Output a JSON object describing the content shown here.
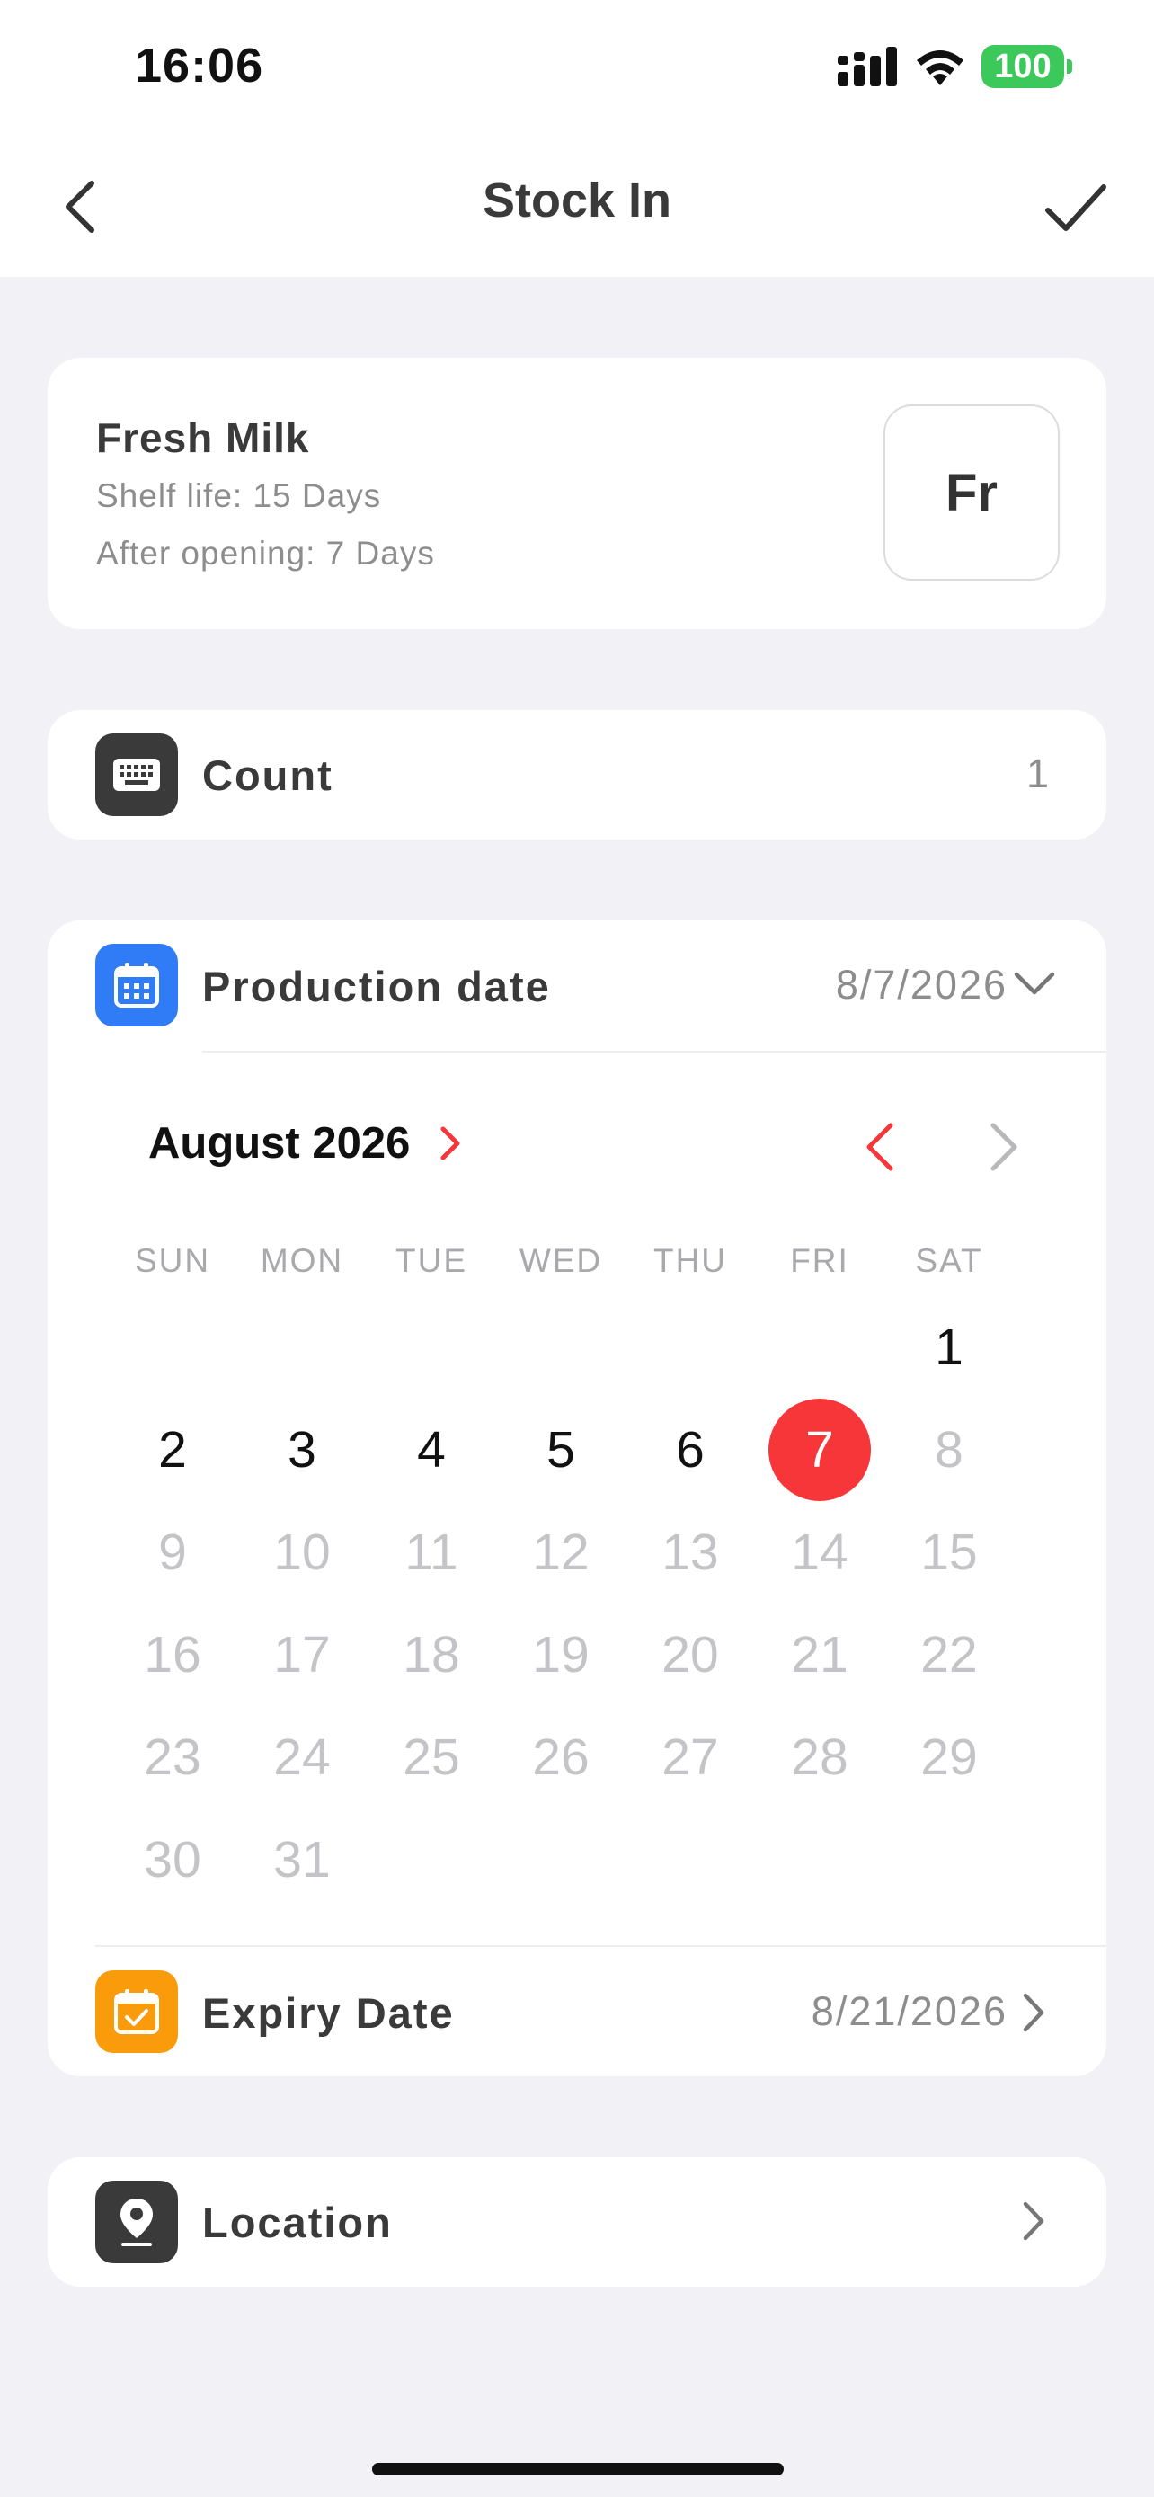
{
  "status": {
    "time": "16:06",
    "battery": "100"
  },
  "nav": {
    "title": "Stock In"
  },
  "product": {
    "name": "Fresh Milk",
    "shelf_life": "Shelf life: 15 Days",
    "after_opening": "After opening: 7 Days",
    "thumb": "Fr"
  },
  "count": {
    "label": "Count",
    "value": "1"
  },
  "production": {
    "label": "Production date",
    "value": "8/7/2026"
  },
  "calendar": {
    "month_label": "August 2026",
    "weekdays": [
      "SUN",
      "MON",
      "TUE",
      "WED",
      "THU",
      "FRI",
      "SAT"
    ],
    "first_weekday_index": 6,
    "days_in_month": 31,
    "selected_day": 7,
    "max_selectable_day": 7,
    "selected_color": "#f7363a"
  },
  "expiry": {
    "label": "Expiry Date",
    "value": "8/21/2026"
  },
  "location": {
    "label": "Location"
  },
  "icons": {
    "back": "chevron-left-icon",
    "confirm": "checkmark-icon",
    "count": "keyboard-icon",
    "production": "calendar-icon",
    "expiry": "calendar-check-icon",
    "location": "location-pin-icon"
  }
}
